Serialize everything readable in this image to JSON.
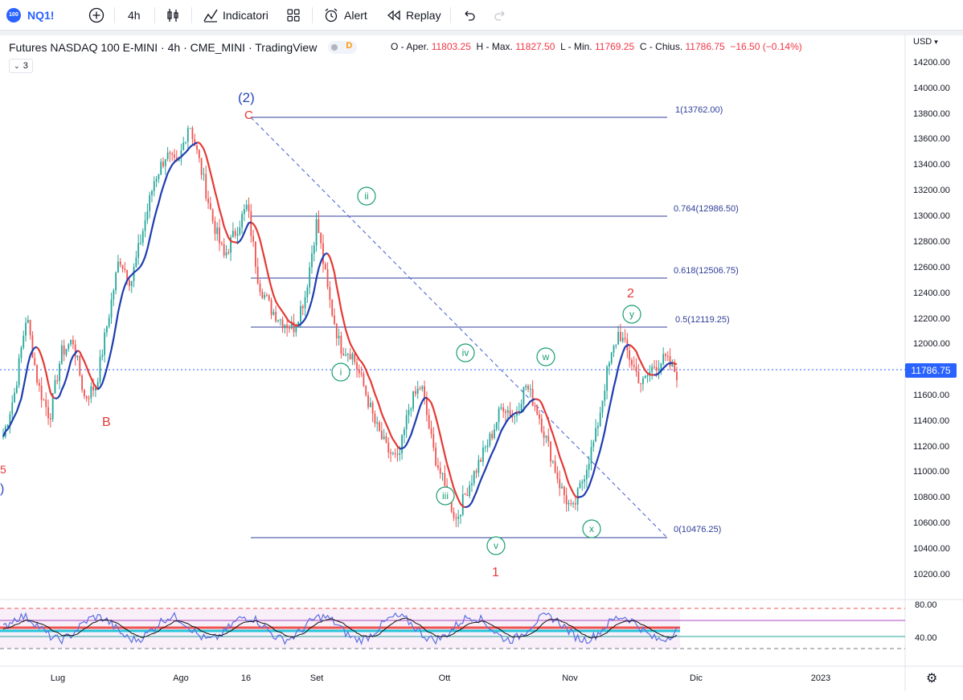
{
  "toolbar": {
    "logo_text": "100",
    "symbol": "NQ1!",
    "add_symbol_icon": "plus-circle-icon",
    "interval": "4h",
    "indicators_label": "Indicatori",
    "alert_label": "Alert",
    "replay_label": "Replay"
  },
  "legend": {
    "title": "Futures NASDAQ 100 E-MINI · 4h · CME_MINI · TradingView",
    "badge_letter": "D",
    "collapse_count": "3",
    "ohlc": {
      "o_label": "O - Aper.",
      "o": "11803.25",
      "h_label": "H - Max.",
      "h": "11827.50",
      "l_label": "L - Min.",
      "l": "11769.25",
      "c_label": "C - Chius.",
      "c": "11786.75",
      "change": "−16.50 (−0.14%)"
    }
  },
  "price_axis": {
    "currency": "USD",
    "labels": [
      "14200.00",
      "14000.00",
      "13800.00",
      "13600.00",
      "13400.00",
      "13200.00",
      "13000.00",
      "12800.00",
      "12600.00",
      "12400.00",
      "12200.00",
      "12000.00",
      "11600.00",
      "11400.00",
      "11200.00",
      "11000.00",
      "10800.00",
      "10600.00",
      "10400.00",
      "10200.00"
    ],
    "current_price": "11786.75",
    "osc_labels": [
      "80.00",
      "40.00"
    ]
  },
  "time_axis": {
    "labels": [
      "Lug",
      "Ago",
      "16",
      "Set",
      "Ott",
      "Nov",
      "Dic",
      "2023"
    ]
  },
  "fib": [
    {
      "label": "1(13762.00)"
    },
    {
      "label": "0.764(12986.50)"
    },
    {
      "label": "0.618(12506.75)"
    },
    {
      "label": "0.5(12119.25)"
    },
    {
      "label": "0(10476.25)"
    }
  ],
  "waves": {
    "w2_big": "(2)",
    "c": "C",
    "b": "B",
    "ii": "ii",
    "i": "i",
    "iii": "iii",
    "iv": "iv",
    "v": "v",
    "one": "1",
    "w": "w",
    "x": "x",
    "y": "y",
    "two": "2",
    "edge_paren": ")",
    "edge_mark": "5"
  },
  "colors": {
    "up": "#26a69a",
    "down": "#ef5350",
    "fib_line": "#2f3e99",
    "wave_red": "#e53935",
    "wave_blue": "#2846b8",
    "wave_green": "#1a9e72",
    "ma_red": "#e53935",
    "ma_blue": "#1e3cb0",
    "rsi_fast": "#5b6ee1",
    "rsi_slow": "#111111",
    "accent": "#2962ff"
  },
  "chart_data": {
    "type": "candlestick",
    "y_axis_range": [
      10100,
      14300
    ],
    "fib_levels": [
      13762.0,
      12986.5,
      12506.75,
      12119.25,
      10476.25
    ],
    "current_price": 11786.75,
    "approx_closes": [
      11300,
      11650,
      12250,
      11700,
      11450,
      11950,
      12050,
      11600,
      11700,
      12200,
      12700,
      12500,
      12900,
      13300,
      13500,
      13400,
      13762,
      13400,
      13000,
      12700,
      12900,
      13100,
      12500,
      12300,
      12200,
      12150,
      12400,
      12986,
      12400,
      12000,
      11950,
      11700,
      11400,
      11200,
      11100,
      11550,
      11700,
      11200,
      10900,
      10650,
      10900,
      11100,
      11300,
      11550,
      11450,
      11700,
      11500,
      11200,
      10900,
      10700,
      11000,
      11300,
      11800,
      12119,
      11900,
      11700,
      11850,
      11900,
      11787
    ],
    "oscillator": {
      "levels": [
        80,
        40
      ]
    }
  }
}
